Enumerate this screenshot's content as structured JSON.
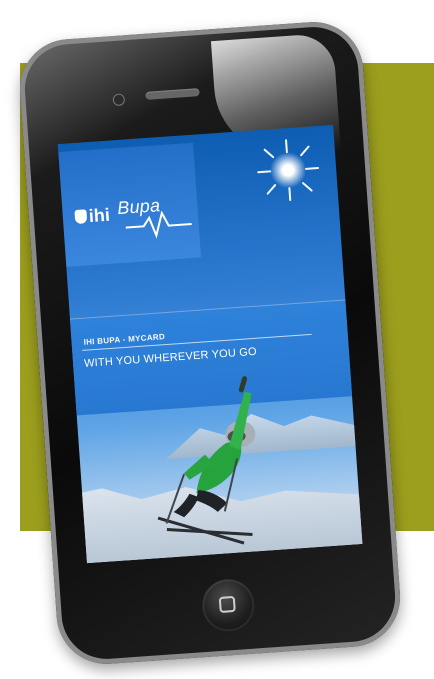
{
  "colors": {
    "background": "#ffffff",
    "accent_olive": "#9c9f1d",
    "screen_blue": "#2e82da",
    "phone_black": "#111111"
  },
  "app": {
    "logo_ihi": "ihi",
    "logo_bupa": "Bupa",
    "banner_title": "IHI BUPA - MYCARD",
    "tagline": "WITH YOU WHEREVER YOU GO"
  },
  "icons": {
    "logo_mark": "ihi-logo",
    "pulse": "pulse-icon",
    "sun": "sun-icon",
    "home": "home-button-icon"
  }
}
